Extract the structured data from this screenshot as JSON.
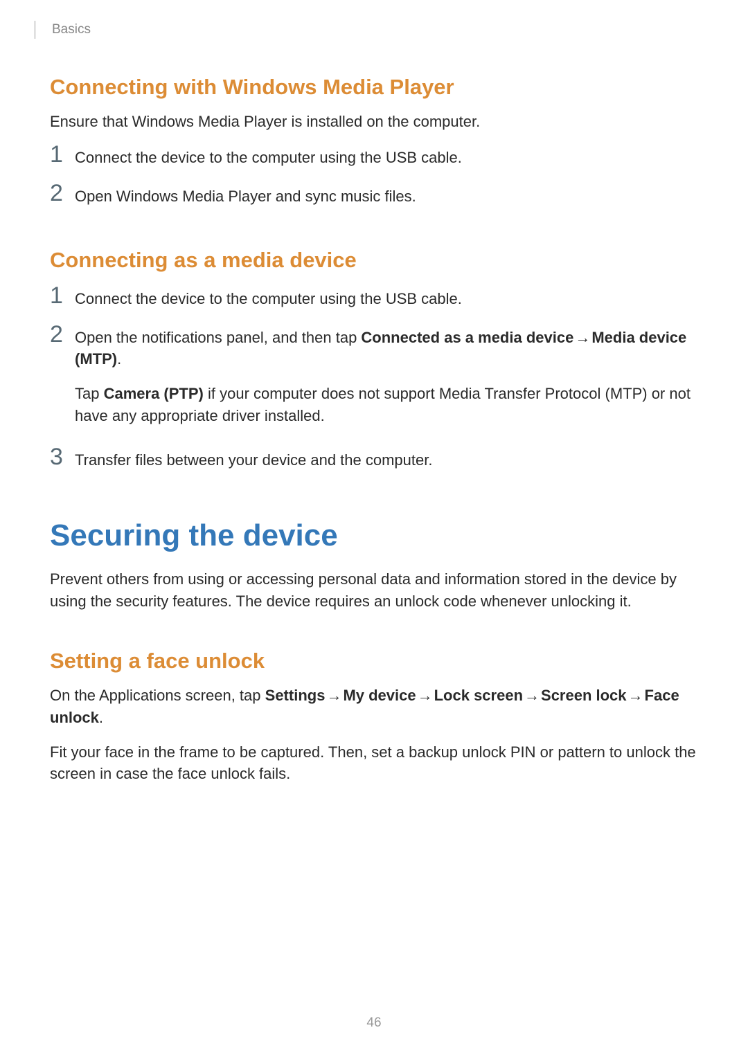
{
  "header": {
    "breadcrumb": "Basics"
  },
  "sections": {
    "s1": {
      "heading": "Connecting with Windows Media Player",
      "intro": "Ensure that Windows Media Player is installed on the computer.",
      "steps": {
        "n1": "1",
        "t1": "Connect the device to the computer using the USB cable.",
        "n2": "2",
        "t2": "Open Windows Media Player and sync music files."
      }
    },
    "s2": {
      "heading": "Connecting as a media device",
      "steps": {
        "n1": "1",
        "t1": "Connect the device to the computer using the USB cable.",
        "n2": "2",
        "t2_pre": "Open the notifications panel, and then tap ",
        "t2_b1": "Connected as a media device",
        "arrow": " → ",
        "t2_b2": "Media device (MTP)",
        "t2_post": ".",
        "t2_sub_pre": "Tap ",
        "t2_sub_b": "Camera (PTP)",
        "t2_sub_post": " if your computer does not support Media Transfer Protocol (MTP) or not have any appropriate driver installed.",
        "n3": "3",
        "t3": "Transfer files between your device and the computer."
      }
    },
    "s3": {
      "heading": "Securing the device",
      "intro": "Prevent others from using or accessing personal data and information stored in the device by using the security features. The device requires an unlock code whenever unlocking it."
    },
    "s4": {
      "heading": "Setting a face unlock",
      "p1_pre": "On the Applications screen, tap ",
      "p1_b1": "Settings",
      "arrow": " → ",
      "p1_b2": "My device",
      "p1_b3": "Lock screen",
      "p1_b4": "Screen lock",
      "p1_b5": "Face unlock",
      "p1_post": ".",
      "p2": "Fit your face in the frame to be captured. Then, set a backup unlock PIN or pattern to unlock the screen in case the face unlock fails."
    }
  },
  "page_number": "46"
}
